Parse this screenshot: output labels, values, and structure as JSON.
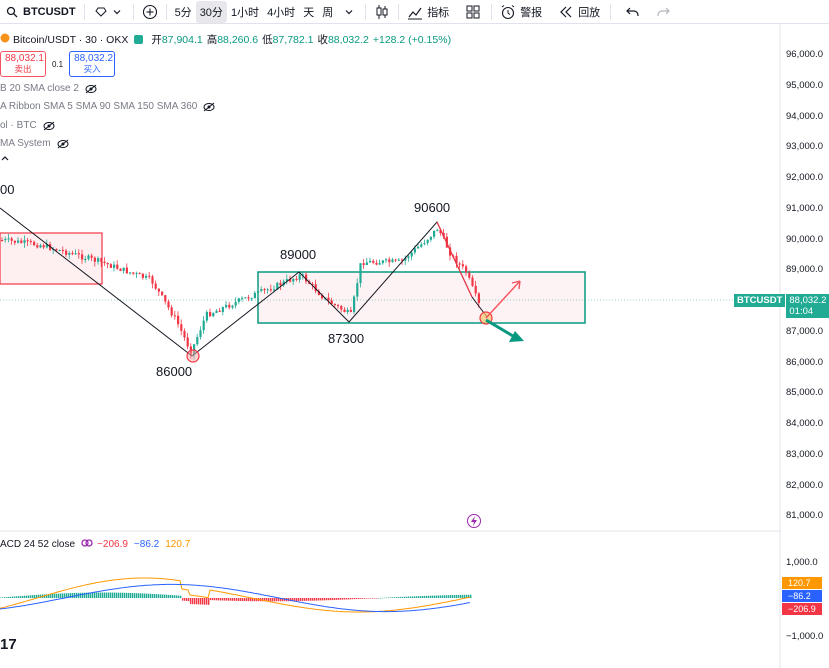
{
  "toolbar": {
    "symbol": "BTCUSDT",
    "intervals": [
      "5分",
      "30分",
      "1小时",
      "4小时",
      "天",
      "周"
    ],
    "active_interval": "30分",
    "indicators_label": "指标",
    "alert_label": "警报",
    "replay_label": "回放"
  },
  "legend": {
    "title": "Bitcoin/USDT · 30 · OKX",
    "open_label": "开",
    "open": "87,904.1",
    "high_label": "高",
    "high": "88,260.6",
    "low_label": "低",
    "low": "87,782.1",
    "close_label": "收",
    "close": "88,032.2",
    "change": "+128.2 (+0.15%)"
  },
  "trade": {
    "sell_price": "88,032.1",
    "sell_label": "卖出",
    "spread": "0.1",
    "buy_price": "88,032.2",
    "buy_label": "买入"
  },
  "indicators": [
    "B 20 SMA close 2",
    "A Ribbon SMA 5 SMA 90 SMA 150 SMA 360",
    "ol · BTC",
    "MA System"
  ],
  "price_axis": [
    "96,000.0",
    "95,000.0",
    "94,000.0",
    "93,000.0",
    "92,000.0",
    "91,000.0",
    "90,000.0",
    "89,000.0",
    "88,000.0",
    "87,000.0",
    "86,000.0",
    "85,000.0",
    "84,000.0",
    "83,000.0",
    "82,000.0",
    "81,000.0"
  ],
  "price_tag": {
    "symbol": "BTCUSDT",
    "price": "88,032.2",
    "countdown": "01:04"
  },
  "annotations": {
    "left_cut": "00",
    "low1": "86000",
    "mid_high": "89000",
    "mid_low": "87300",
    "peak": "90600"
  },
  "macd": {
    "title": "ACD 24 52 close",
    "hist": "−206.9",
    "signal": "−86.2",
    "macd": "120.7",
    "axis_top": "1,000.0",
    "axis_bottom": "−1,000.0",
    "tags": [
      "120.7",
      "−86.2",
      "−206.9"
    ]
  },
  "colors": {
    "up": "#22ab94",
    "down": "#f23645",
    "zone_red": "#f23645",
    "zone_green": "#089981",
    "arrow_red": "#f7525f",
    "arrow_green": "#089981"
  },
  "logo": "17"
}
